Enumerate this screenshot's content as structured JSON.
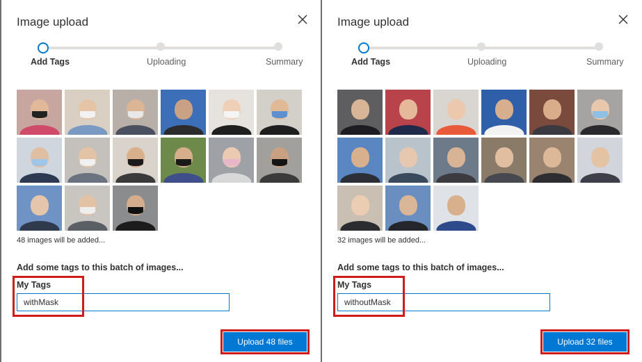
{
  "panels": [
    {
      "title": "Image upload",
      "steps": [
        "Add Tags",
        "Uploading",
        "Summary"
      ],
      "thumbnails": [
        {
          "bg": "#c7a6a0",
          "skin": "#e2b89a",
          "shirt": "#d04a6a",
          "mask": "#222222"
        },
        {
          "bg": "#d9cfc2",
          "skin": "#e6c4a8",
          "shirt": "#7a9ac4",
          "mask": "#f2f2f2"
        },
        {
          "bg": "#b8b0a8",
          "skin": "#dcb596",
          "shirt": "#4a5060",
          "mask": "#e8e8e8"
        },
        {
          "bg": "#3d6fb8",
          "skin": "#c9a184",
          "shirt": "#2c2c2c",
          "mask": ""
        },
        {
          "bg": "#e6e2de",
          "skin": "#efd0b6",
          "shirt": "#1f1f1f",
          "mask": "#f5f5f5"
        },
        {
          "bg": "#d3cfc9",
          "skin": "#e0b996",
          "shirt": "#1e1e1e",
          "mask": "#5e8fd1"
        },
        {
          "bg": "#cfd6de",
          "skin": "#e0bea2",
          "shirt": "#2d3a52",
          "mask": "#9fc6e8"
        },
        {
          "bg": "#c4c1bc",
          "skin": "#e3c3a6",
          "shirt": "#6b7280",
          "mask": "#f0f0f0"
        },
        {
          "bg": "#dad3cb",
          "skin": "#d9b08c",
          "shirt": "#3a3a3a",
          "mask": "#1b1b1b"
        },
        {
          "bg": "#6e8a4a",
          "skin": "#d7ae8c",
          "shirt": "#3f4f8a",
          "mask": "#1a1a1a"
        },
        {
          "bg": "#9ea1a6",
          "skin": "#ebcab2",
          "shirt": "#d8d8d8",
          "mask": "#e7b6c8"
        },
        {
          "bg": "#a2a09d",
          "skin": "#c9a182",
          "shirt": "#3b3b3b",
          "mask": "#151515"
        },
        {
          "bg": "#6f93c4",
          "skin": "#e5c6ad",
          "shirt": "#2f3a4c",
          "mask": ""
        },
        {
          "bg": "#c9c6c2",
          "skin": "#e2c2a4",
          "shirt": "#5a5f66",
          "mask": "#eeeeee"
        },
        {
          "bg": "#8b8c8e",
          "skin": "#d4ad8e",
          "shirt": "#1c1c1c",
          "mask": "#111111"
        }
      ],
      "count_text": "48 images will be added...",
      "tags_heading": "Add some tags to this batch of images...",
      "tags_label": "My Tags",
      "tags_value": "withMask",
      "upload_label": "Upload 48 files"
    },
    {
      "title": "Image upload",
      "steps": [
        "Add Tags",
        "Uploading",
        "Summary"
      ],
      "thumbnails": [
        {
          "bg": "#5e5e60",
          "skin": "#d8b596",
          "shirt": "#1c1c22",
          "mask": ""
        },
        {
          "bg": "#b8434a",
          "skin": "#e6b89a",
          "shirt": "#1f2a4a",
          "mask": ""
        },
        {
          "bg": "#d9d6d2",
          "skin": "#ecc9ac",
          "shirt": "#e85a3a",
          "mask": ""
        },
        {
          "bg": "#2f5fa8",
          "skin": "#d7ae8e",
          "shirt": "#f2f2f2",
          "mask": ""
        },
        {
          "bg": "#7a4a3c",
          "skin": "#d8ad8a",
          "shirt": "#3a3a40",
          "mask": ""
        },
        {
          "bg": "#a6a4a2",
          "skin": "#e8c7ac",
          "shirt": "#2a2a2e",
          "mask": "#8ec0e6"
        },
        {
          "bg": "#5a86c2",
          "skin": "#d8b08e",
          "shirt": "#2c2f36",
          "mask": ""
        },
        {
          "bg": "#b8c3cc",
          "skin": "#e6c8b0",
          "shirt": "#3a4a5c",
          "mask": ""
        },
        {
          "bg": "#6d7a8a",
          "skin": "#d8b496",
          "shirt": "#3c3c40",
          "mask": ""
        },
        {
          "bg": "#8a7a68",
          "skin": "#e2bea0",
          "shirt": "#484850",
          "mask": ""
        },
        {
          "bg": "#9a8470",
          "skin": "#dcb898",
          "shirt": "#2e2e32",
          "mask": ""
        },
        {
          "bg": "#d2d6dc",
          "skin": "#e4c2a4",
          "shirt": "#3d4048",
          "mask": ""
        },
        {
          "bg": "#c9bfb2",
          "skin": "#ebcdb4",
          "shirt": "#2a2c30",
          "mask": ""
        },
        {
          "bg": "#6a8ec0",
          "skin": "#d9b698",
          "shirt": "#24262c",
          "mask": ""
        },
        {
          "bg": "#dfe3e8",
          "skin": "#d9b08c",
          "shirt": "#2e4a8a",
          "mask": ""
        }
      ],
      "count_text": "32 images will be added...",
      "tags_heading": "Add some tags to this batch of images...",
      "tags_label": "My Tags",
      "tags_value": "withoutMask",
      "upload_label": "Upload 32 files"
    }
  ]
}
